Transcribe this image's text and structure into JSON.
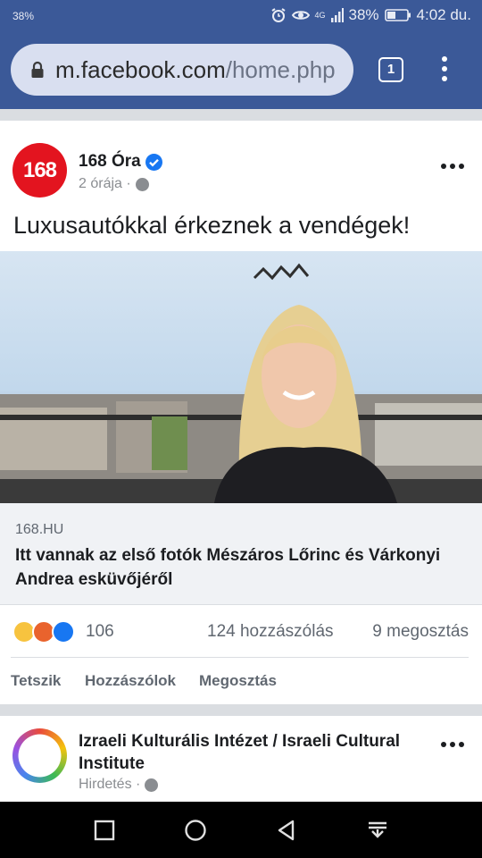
{
  "status_bar": {
    "left_text": "38",
    "battery": "38%",
    "time": "4:02 du.",
    "network": "4G"
  },
  "browser": {
    "url_host": "m.facebook.com",
    "url_path": "/home.php",
    "tab_count": "1",
    "accent": "#3b5998"
  },
  "post": {
    "page_name": "168 Óra",
    "avatar_text": "168",
    "time": "2 órája",
    "separator": " ·",
    "text": "Luxusautókkal érkeznek a vendégek!",
    "link": {
      "domain": "168.HU",
      "title": "Itt vannak az első fotók Mészáros Lőrinc és Várkonyi Andrea esküvőjéről"
    },
    "reaction_count": "106",
    "comments": "124 hozzászólás",
    "shares": "9 megosztás",
    "actions": {
      "like": "Tetszik",
      "comment": "Hozzászólok",
      "share": "Megosztás"
    }
  },
  "ad_post": {
    "page_name": "Izraeli Kulturális Intézet / Israeli Cultural Institute",
    "label": "Hirdetés",
    "separator": " ·"
  }
}
